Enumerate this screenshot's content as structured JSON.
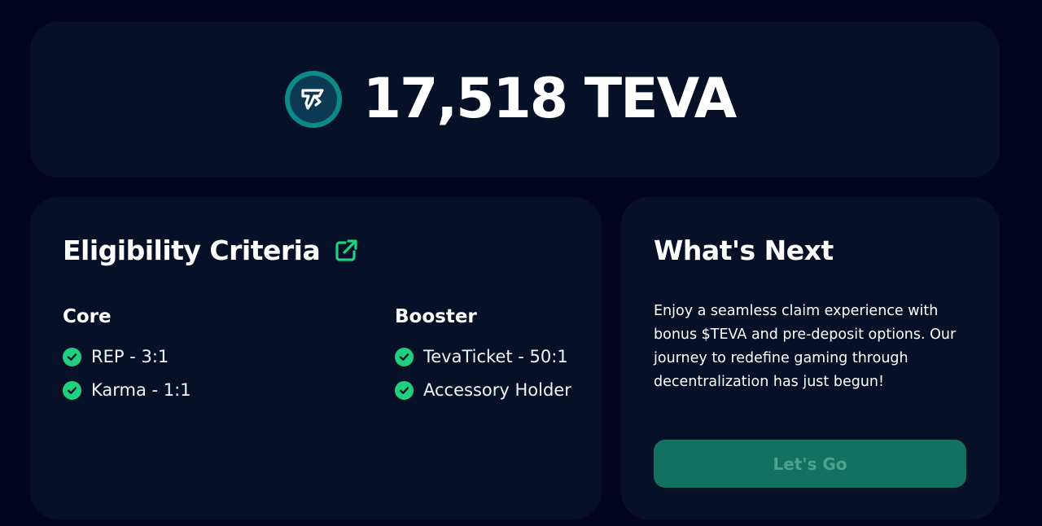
{
  "balance": {
    "amount": "17,518 TEVA",
    "icon": "teva-coin-icon"
  },
  "eligibility": {
    "title": "Eligibility Criteria",
    "link_icon": "external-link-icon",
    "core": {
      "title": "Core",
      "items": [
        {
          "label": "REP - 3:1",
          "icon": "check-circle-icon"
        },
        {
          "label": "Karma - 1:1",
          "icon": "check-circle-icon"
        }
      ]
    },
    "booster": {
      "title": "Booster",
      "items": [
        {
          "label": "TevaTicket - 50:1",
          "icon": "check-circle-icon"
        },
        {
          "label": "Accessory Holder",
          "icon": "check-circle-icon"
        }
      ]
    }
  },
  "next": {
    "title": "What's Next",
    "description": "Enjoy a seamless claim experience with bonus $TEVA and pre-deposit options. Our journey to redefine gaming through decentralization has just begun!",
    "button_label": "Let's Go"
  },
  "colors": {
    "background": "#03041f",
    "card": "#061128",
    "accent": "#1fd17f",
    "button": "#12725f",
    "button_text": "#4fa18b"
  }
}
